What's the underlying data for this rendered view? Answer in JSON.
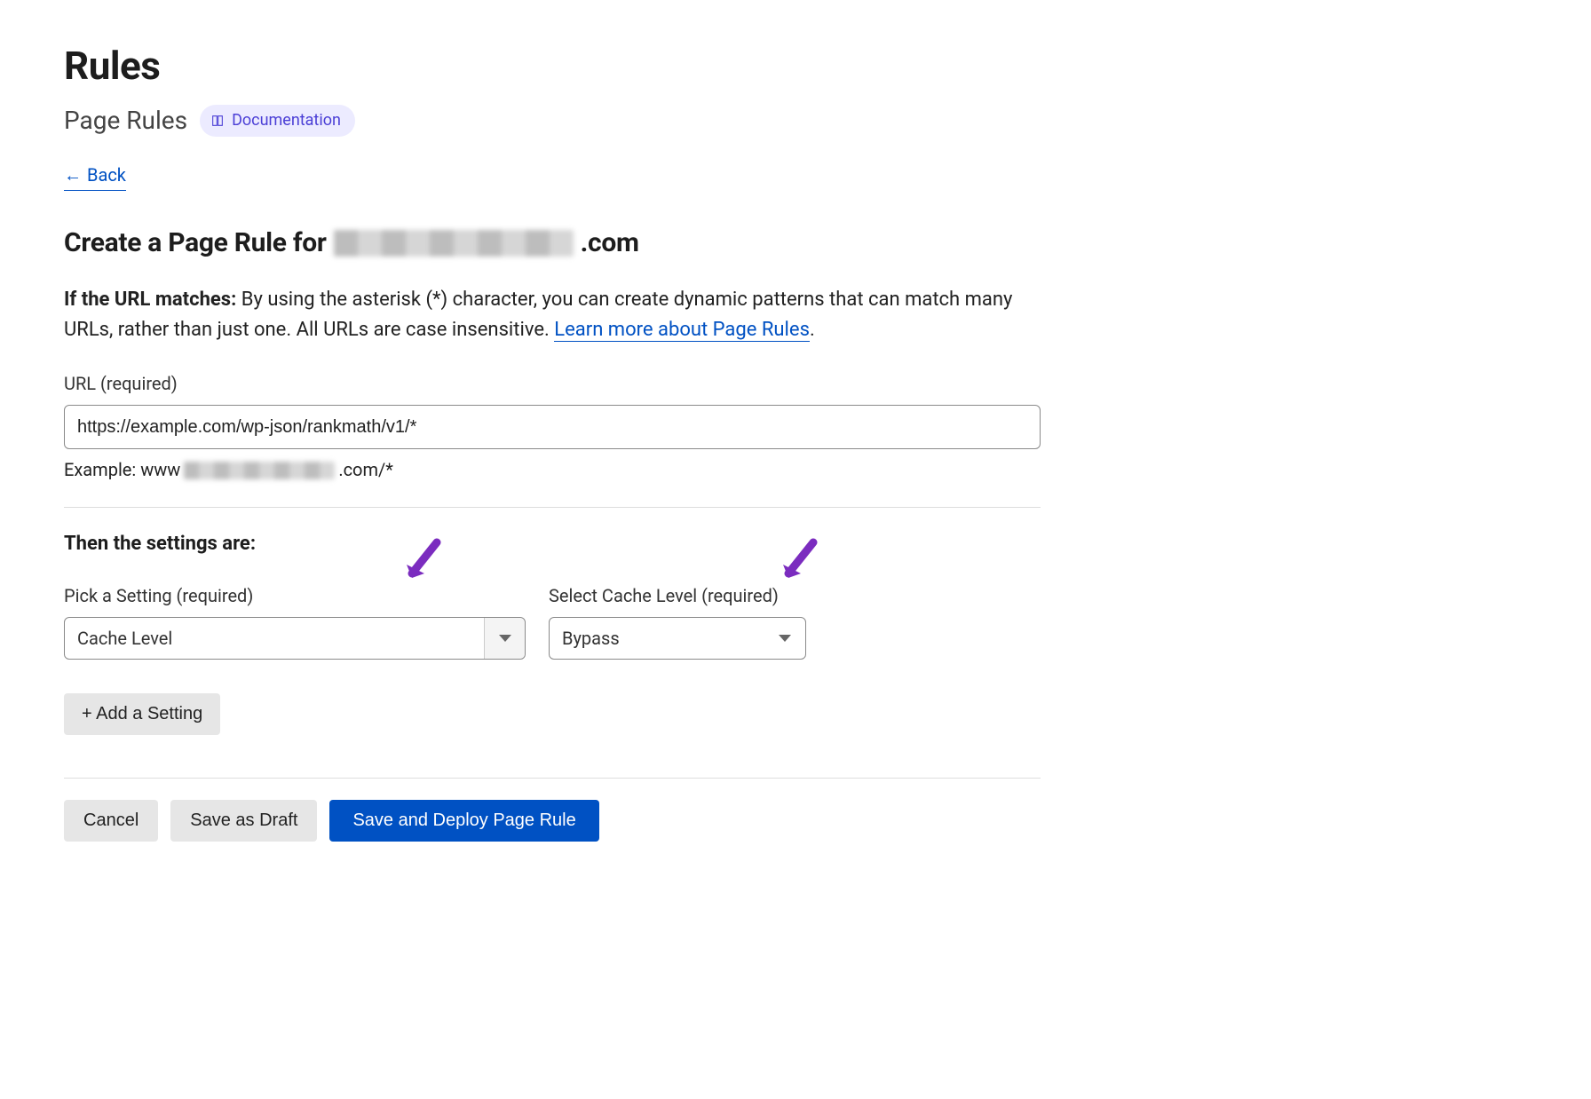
{
  "header": {
    "title": "Rules",
    "subtitle": "Page Rules",
    "doc_label": "Documentation",
    "back_label": "Back"
  },
  "form": {
    "heading_prefix": "Create a Page Rule for",
    "heading_suffix": ".com",
    "intro_strong": "If the URL matches:",
    "intro_text": " By using the asterisk (*) character, you can create dynamic patterns that can match many URLs, rather than just one. All URLs are case insensitive. ",
    "learn_more": "Learn more about Page Rules",
    "url_label": "URL (required)",
    "url_value": "https://example.com/wp-json/rankmath/v1/*",
    "example_prefix": "Example: www",
    "example_suffix": ".com/*",
    "settings_heading": "Then the settings are:",
    "pick_setting_label": "Pick a Setting (required)",
    "pick_setting_value": "Cache Level",
    "cache_level_label": "Select Cache Level (required)",
    "cache_level_value": "Bypass",
    "add_setting": "+ Add a Setting"
  },
  "actions": {
    "cancel": "Cancel",
    "save_draft": "Save as Draft",
    "save_deploy": "Save and Deploy Page Rule"
  }
}
